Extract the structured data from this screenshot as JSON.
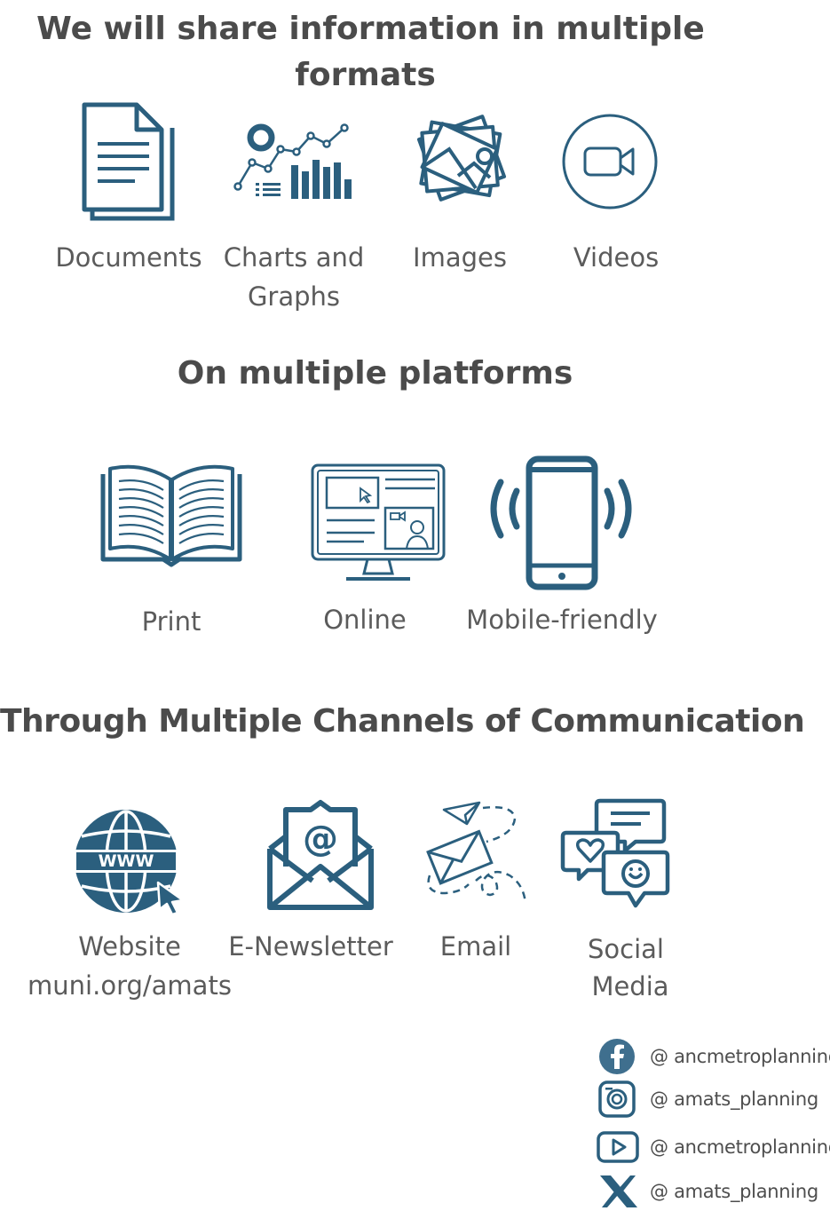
{
  "headings": {
    "formats_line1": "We will share information in multiple",
    "formats_line2": "formats",
    "platforms": "On multiple platforms",
    "channels": "Through Multiple Channels of Communication"
  },
  "formats": [
    {
      "icon": "document-icon",
      "label": "Documents"
    },
    {
      "icon": "charts-graphs-icon",
      "label_line1": "Charts and",
      "label_line2": "Graphs"
    },
    {
      "icon": "images-icon",
      "label": "Images"
    },
    {
      "icon": "video-camera-icon",
      "label": "Videos"
    }
  ],
  "platforms": [
    {
      "icon": "open-book-icon",
      "label": "Print"
    },
    {
      "icon": "computer-monitor-icon",
      "label": "Online"
    },
    {
      "icon": "mobile-phone-icon",
      "label": "Mobile-friendly"
    }
  ],
  "channels": [
    {
      "icon": "globe-www-icon",
      "label_line1": "Website",
      "label_line2": "muni.org/amats"
    },
    {
      "icon": "envelope-at-icon",
      "label": "E-Newsletter"
    },
    {
      "icon": "paper-plane-envelope-icon",
      "label": "Email"
    },
    {
      "icon": "speech-bubbles-icon",
      "label_line1": "Social",
      "label_line2": "Media"
    }
  ],
  "social": [
    {
      "icon": "facebook-icon",
      "handle": "@ ancmetroplanning"
    },
    {
      "icon": "instagram-icon",
      "handle": "@ amats_planning"
    },
    {
      "icon": "youtube-icon",
      "handle": "@ ancmetroplanning"
    },
    {
      "icon": "x-icon",
      "handle": "@ amats_planning"
    }
  ],
  "colors": {
    "icon_blue": "#2b5f7e",
    "heading_text": "#4b4b4b",
    "label_text": "#5b5b5b"
  }
}
